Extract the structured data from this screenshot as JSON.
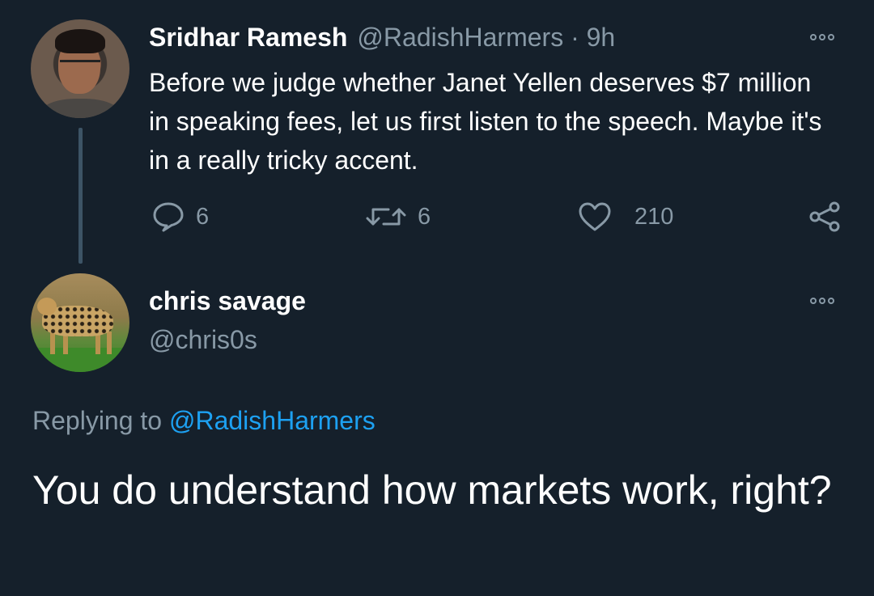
{
  "parent_tweet": {
    "author_name": "Sridhar Ramesh",
    "author_handle": "@RadishHarmers",
    "separator": "·",
    "time": "9h",
    "text": "Before we judge whether Janet Yellen deserves $7 million in speaking fees, let us first listen to the speech. Maybe it's in a really tricky accent.",
    "actions": {
      "reply_count": "6",
      "retweet_count": "6",
      "like_count": "210"
    }
  },
  "reply_tweet": {
    "author_name": "chris savage",
    "author_handle": "@chris0s",
    "replying_prefix": "Replying to",
    "replying_to": "@RadishHarmers",
    "text": "You do understand how markets work, right?"
  },
  "icons": {
    "reply": "speech-bubble-icon",
    "retweet": "retweet-icon",
    "like": "heart-icon",
    "share": "share-icon",
    "more": "more-options-icon"
  },
  "colors": {
    "background": "#15202b",
    "text_primary": "#ffffff",
    "text_muted": "#8899a6",
    "link": "#1da1f2",
    "thread_line": "#3d5466"
  }
}
